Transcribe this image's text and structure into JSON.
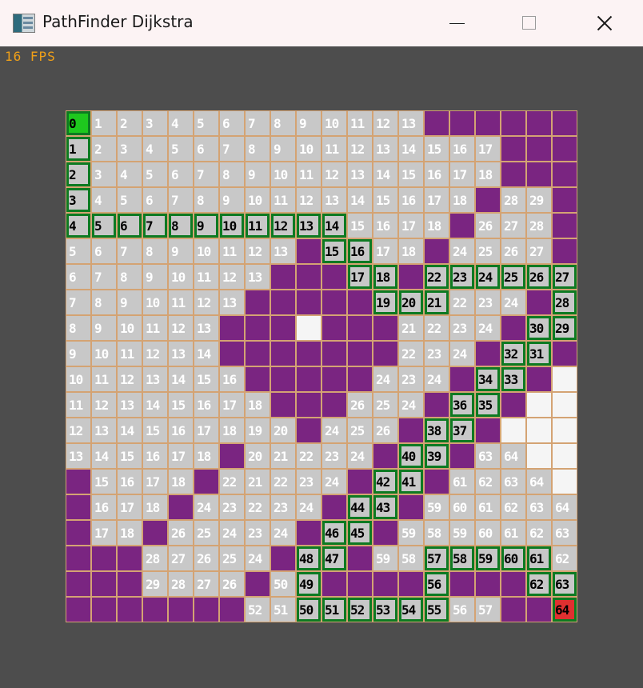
{
  "window": {
    "title": "PathFinder Dijkstra"
  },
  "hud": {
    "fps": "16 FPS"
  },
  "colors": {
    "wall": "#7a2581",
    "visited": "#c8c8c8",
    "path": "#0d7a22",
    "start": "#1ec81e",
    "goal": "#e03030",
    "unvisited": "#f5f5f5",
    "fps_text": "#f0a018"
  },
  "grid": {
    "legend": "W = wall, E = unvisited empty cell, number = distance; suffix p = shortest path, s = start, g = goal",
    "rows": [
      [
        "0s",
        "1",
        "2",
        "3",
        "4",
        "5",
        "6",
        "7",
        "8",
        "9",
        "10",
        "11",
        "12",
        "13",
        "W",
        "W",
        "W",
        "W",
        "W",
        "W"
      ],
      [
        "1p",
        "2",
        "3",
        "4",
        "5",
        "6",
        "7",
        "8",
        "9",
        "10",
        "11",
        "12",
        "13",
        "14",
        "15",
        "16",
        "17",
        "W",
        "W",
        "W"
      ],
      [
        "2p",
        "3",
        "4",
        "5",
        "6",
        "7",
        "8",
        "9",
        "10",
        "11",
        "12",
        "13",
        "14",
        "15",
        "16",
        "17",
        "18",
        "W",
        "W",
        "W"
      ],
      [
        "3p",
        "4",
        "5",
        "6",
        "7",
        "8",
        "9",
        "10",
        "11",
        "12",
        "13",
        "14",
        "15",
        "16",
        "17",
        "18",
        "W",
        "28",
        "29",
        "W"
      ],
      [
        "4p",
        "5p",
        "6p",
        "7p",
        "8p",
        "9p",
        "10p",
        "11p",
        "12p",
        "13p",
        "14p",
        "15",
        "16",
        "17",
        "18",
        "W",
        "26",
        "27",
        "28",
        "W"
      ],
      [
        "5",
        "6",
        "7",
        "8",
        "9",
        "10",
        "11",
        "12",
        "13",
        "W",
        "15p",
        "16p",
        "17",
        "18",
        "W",
        "24",
        "25",
        "26",
        "27",
        "W"
      ],
      [
        "6",
        "7",
        "8",
        "9",
        "10",
        "11",
        "12",
        "13",
        "W",
        "W",
        "W",
        "17p",
        "18p",
        "W",
        "22p",
        "23p",
        "24p",
        "25p",
        "26p",
        "27p"
      ],
      [
        "7",
        "8",
        "9",
        "10",
        "11",
        "12",
        "13",
        "W",
        "W",
        "W",
        "W",
        "W",
        "19p",
        "20p",
        "21p",
        "22",
        "23",
        "24",
        "W",
        "28p"
      ],
      [
        "8",
        "9",
        "10",
        "11",
        "12",
        "13",
        "W",
        "W",
        "W",
        "E",
        "W",
        "W",
        "W",
        "21",
        "22",
        "23",
        "24",
        "W",
        "30p",
        "29p"
      ],
      [
        "9",
        "10",
        "11",
        "12",
        "13",
        "14",
        "W",
        "W",
        "W",
        "W",
        "W",
        "W",
        "W",
        "22",
        "23",
        "24",
        "W",
        "32p",
        "31p",
        "W"
      ],
      [
        "10",
        "11",
        "12",
        "13",
        "14",
        "15",
        "16",
        "W",
        "W",
        "W",
        "W",
        "W",
        "24",
        "23",
        "24",
        "W",
        "34p",
        "33p",
        "W",
        "E"
      ],
      [
        "11",
        "12",
        "13",
        "14",
        "15",
        "16",
        "17",
        "18",
        "W",
        "W",
        "W",
        "26",
        "25",
        "24",
        "W",
        "36p",
        "35p",
        "W",
        "E",
        "E"
      ],
      [
        "12",
        "13",
        "14",
        "15",
        "16",
        "17",
        "18",
        "19",
        "20",
        "W",
        "24",
        "25",
        "26",
        "W",
        "38p",
        "37p",
        "W",
        "E",
        "E",
        "E"
      ],
      [
        "13",
        "14",
        "15",
        "16",
        "17",
        "18",
        "W",
        "20",
        "21",
        "22",
        "23",
        "24",
        "W",
        "40p",
        "39p",
        "W",
        "63",
        "64",
        "E",
        "E"
      ],
      [
        "W",
        "15",
        "16",
        "17",
        "18",
        "W",
        "22",
        "21",
        "22",
        "23",
        "24",
        "W",
        "42p",
        "41p",
        "W",
        "61",
        "62",
        "63",
        "64",
        "E"
      ],
      [
        "W",
        "16",
        "17",
        "18",
        "W",
        "24",
        "23",
        "22",
        "23",
        "24",
        "W",
        "44p",
        "43p",
        "W",
        "59",
        "60",
        "61",
        "62",
        "63",
        "64"
      ],
      [
        "W",
        "17",
        "18",
        "W",
        "26",
        "25",
        "24",
        "23",
        "24",
        "W",
        "46p",
        "45p",
        "W",
        "59",
        "58",
        "59",
        "60",
        "61",
        "62",
        "63"
      ],
      [
        "W",
        "W",
        "W",
        "28",
        "27",
        "26",
        "25",
        "24",
        "W",
        "48p",
        "47p",
        "W",
        "59",
        "58",
        "57p",
        "58p",
        "59p",
        "60p",
        "61p",
        "62"
      ],
      [
        "W",
        "W",
        "W",
        "29",
        "28",
        "27",
        "26",
        "W",
        "50",
        "49p",
        "W",
        "W",
        "W",
        "W",
        "56p",
        "W",
        "W",
        "W",
        "62p",
        "63p"
      ],
      [
        "W",
        "W",
        "W",
        "W",
        "W",
        "W",
        "W",
        "52",
        "51",
        "50p",
        "51p",
        "52p",
        "53p",
        "54p",
        "55p",
        "56",
        "57",
        "W",
        "W",
        "64g"
      ]
    ]
  }
}
